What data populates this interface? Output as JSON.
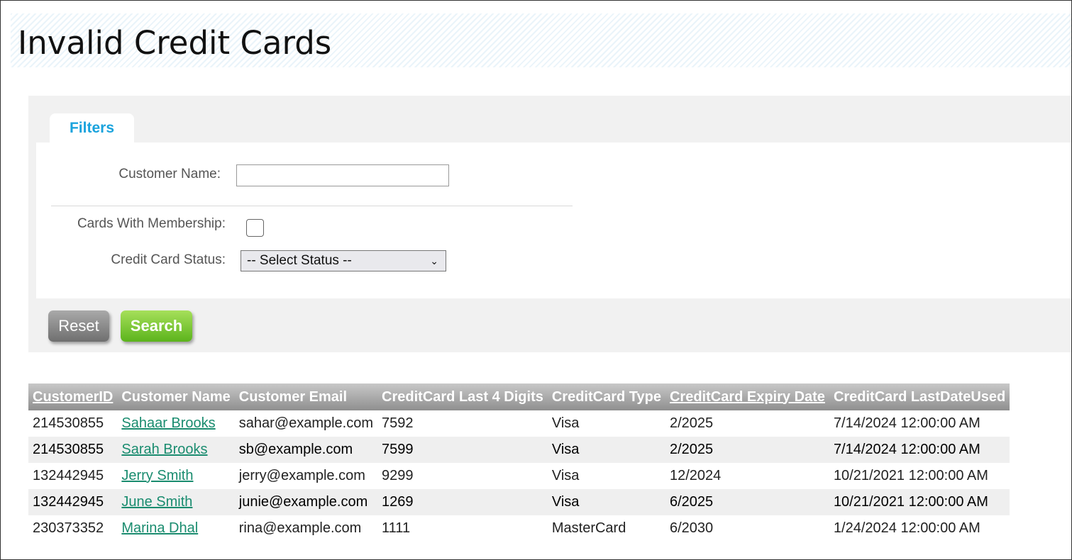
{
  "page": {
    "title": "Invalid Credit Cards"
  },
  "filters": {
    "tab_label": "Filters",
    "customer_name": {
      "label": "Customer Name:",
      "value": "",
      "placeholder": ""
    },
    "cards_with_membership": {
      "label": "Cards With Membership:",
      "checked": false
    },
    "credit_card_status": {
      "label": "Credit Card Status:",
      "selected": "-- Select Status --"
    },
    "reset_label": "Reset",
    "search_label": "Search"
  },
  "table": {
    "columns": [
      {
        "label": "CustomerID",
        "sortable": true
      },
      {
        "label": "Customer Name",
        "sortable": false
      },
      {
        "label": "Customer Email",
        "sortable": false
      },
      {
        "label": "CreditCard Last 4 Digits",
        "sortable": false
      },
      {
        "label": "CreditCard Type",
        "sortable": false
      },
      {
        "label": "CreditCard Expiry Date",
        "sortable": true
      },
      {
        "label": "CreditCard LastDateUsed",
        "sortable": false
      }
    ],
    "rows": [
      {
        "customer_id": "214530855",
        "name": "Sahaar Brooks",
        "email": "sahar@example.com",
        "last4": "7592",
        "type": "Visa",
        "expiry": "2/2025",
        "last_used": "7/14/2024 12:00:00 AM"
      },
      {
        "customer_id": "214530855",
        "name": "Sarah Brooks",
        "email": "sb@example.com",
        "last4": "7599",
        "type": "Visa",
        "expiry": "2/2025",
        "last_used": "7/14/2024 12:00:00 AM"
      },
      {
        "customer_id": "132442945",
        "name": "Jerry Smith",
        "email": "jerry@example.com",
        "last4": "9299",
        "type": "Visa",
        "expiry": "12/2024",
        "last_used": "10/21/2021 12:00:00 AM"
      },
      {
        "customer_id": "132442945",
        "name": "June Smith",
        "email": "junie@example.com",
        "last4": "1269",
        "type": "Visa",
        "expiry": "6/2025",
        "last_used": "10/21/2021 12:00:00 AM"
      },
      {
        "customer_id": "230373352",
        "name": "Marina Dhal",
        "email": "rina@example.com",
        "last4": "1111",
        "type": "MasterCard",
        "expiry": "6/2030",
        "last_used": "1/24/2024 12:00:00 AM"
      }
    ]
  },
  "colors": {
    "tab_accent": "#1aa3dd",
    "link": "#1a8c6f",
    "search_button": "#5cb41c",
    "reset_button": "#6f6f6f"
  },
  "icons": {
    "select_arrow": "chevron-down-icon"
  }
}
